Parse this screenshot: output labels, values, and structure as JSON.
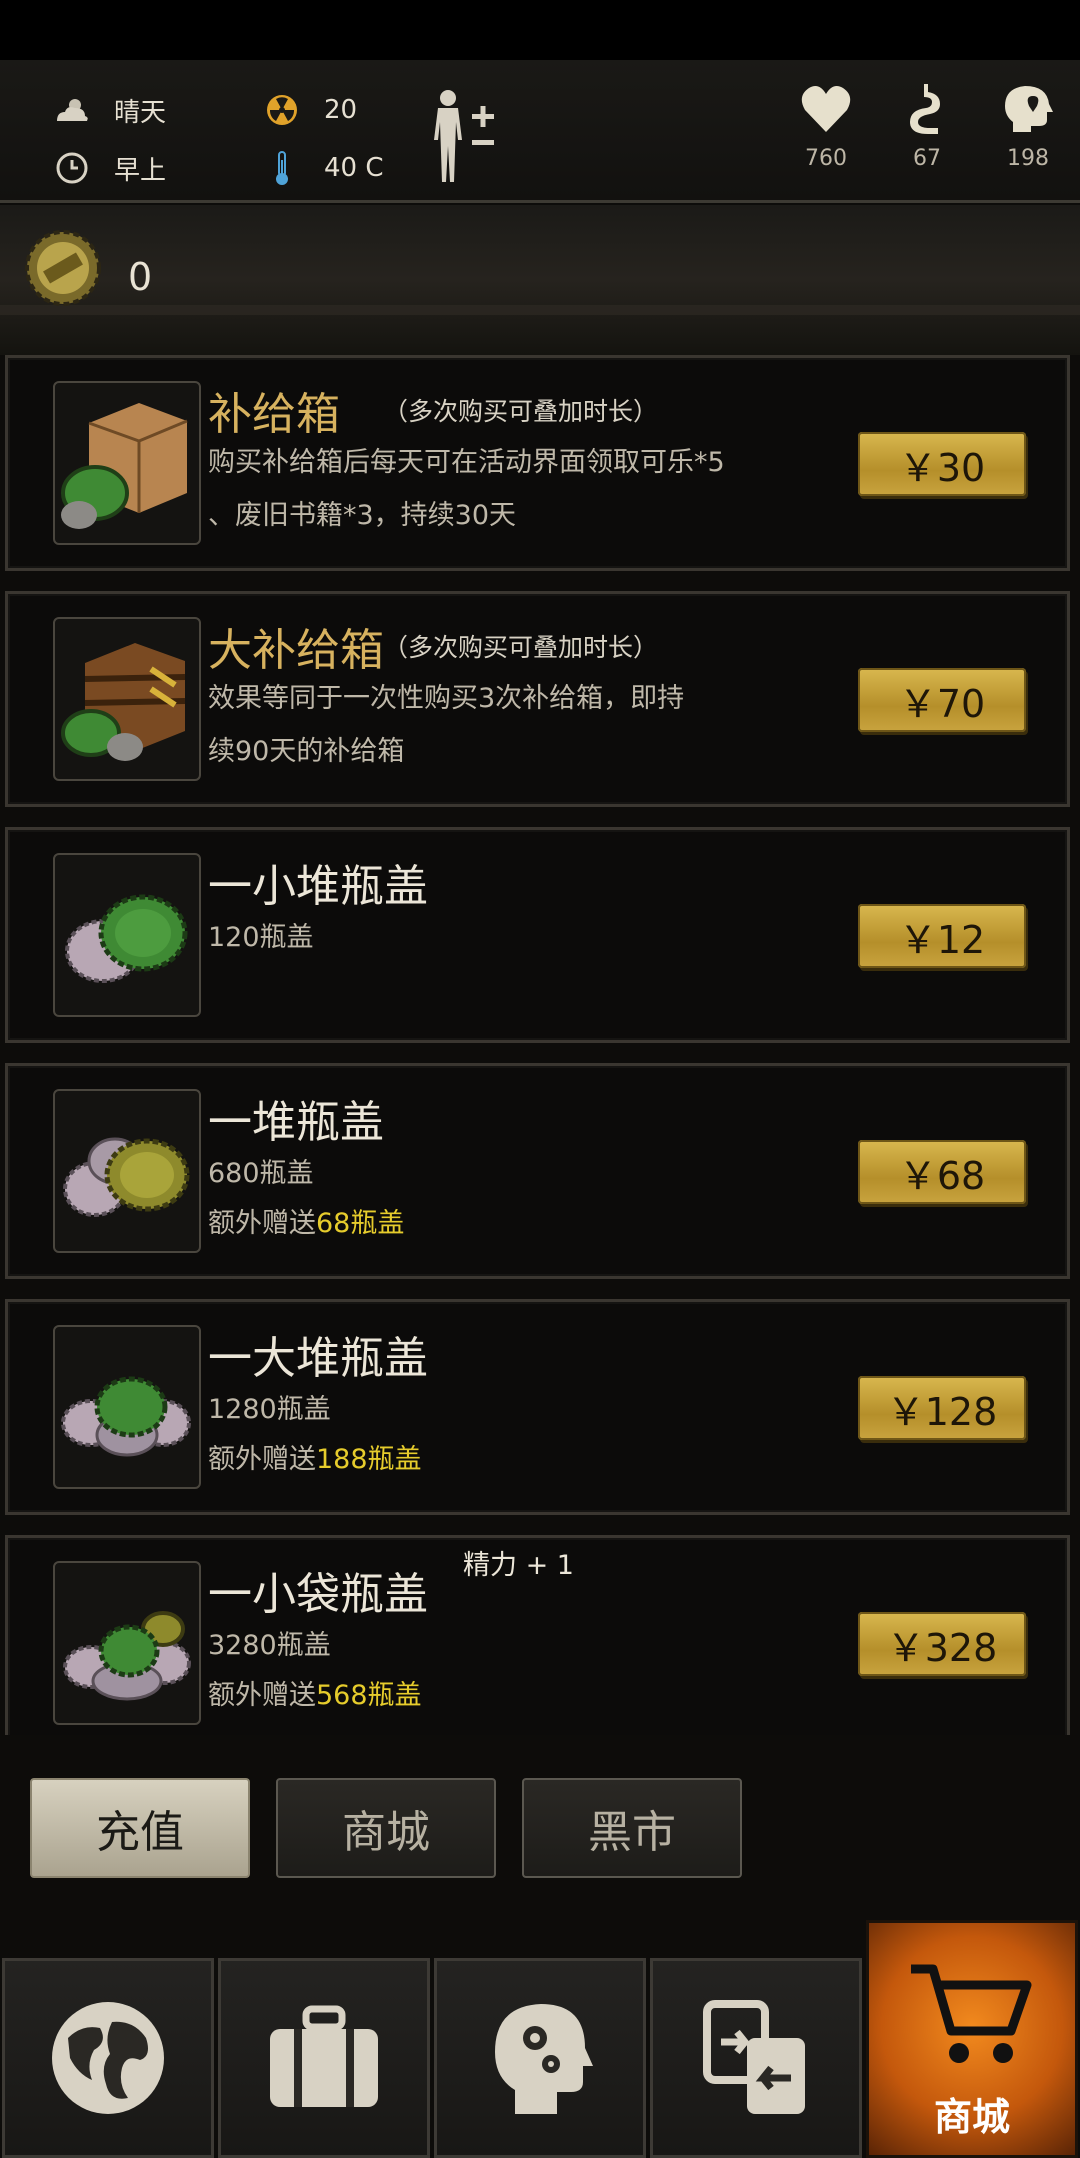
{
  "hud": {
    "weather": "晴天",
    "time_of_day": "早上",
    "radiation": "20",
    "temperature": "40 C",
    "health": "760",
    "hunger": "67",
    "mental": "198"
  },
  "currency": {
    "caps_count": "0"
  },
  "shop_items": [
    {
      "title": "补给箱",
      "note": "（多次购买可叠加时长）",
      "desc_line1": "购买补给箱后每天可在活动界面领取可乐*5",
      "desc_line2": "、废旧书籍*3，持续30天",
      "price": "￥30"
    },
    {
      "title": "大补给箱",
      "note": "（多次购买可叠加时长）",
      "desc_line1": "效果等同于一次性购买3次补给箱，即持",
      "desc_line2": "续90天的补给箱",
      "price": "￥70"
    },
    {
      "title": "一小堆瓶盖",
      "amount": "120瓶盖",
      "price": "￥12"
    },
    {
      "title": "一堆瓶盖",
      "amount": "680瓶盖",
      "bonus_prefix": "额外赠送",
      "bonus_value": "68瓶盖",
      "price": "￥68"
    },
    {
      "title": "一大堆瓶盖",
      "amount": "1280瓶盖",
      "bonus_prefix": "额外赠送",
      "bonus_value": "188瓶盖",
      "price": "￥128"
    },
    {
      "title": "一小袋瓶盖",
      "amount": "3280瓶盖",
      "bonus_prefix": "额外赠送",
      "bonus_value": "568瓶盖",
      "price": "￥328"
    }
  ],
  "floating_text": "精力 + 1",
  "tabs": [
    "充值",
    "商城",
    "黑市"
  ],
  "bottom_nav": {
    "shop_label": "商城"
  },
  "icons": [
    "weather-sun-cloud-icon",
    "clock-icon",
    "radiation-icon",
    "thermometer-icon",
    "body-icon",
    "heart-icon",
    "stomach-icon",
    "brain-icon",
    "bottle-cap-icon",
    "globe-icon",
    "suitcase-icon",
    "head-gears-icon",
    "swap-icon",
    "cart-icon"
  ],
  "colors": {
    "gold_title": "#d7b25f",
    "bonus_yellow": "#e6cc2c",
    "price_gold": "#d9b84f",
    "active_nav": "#f28a1e"
  }
}
